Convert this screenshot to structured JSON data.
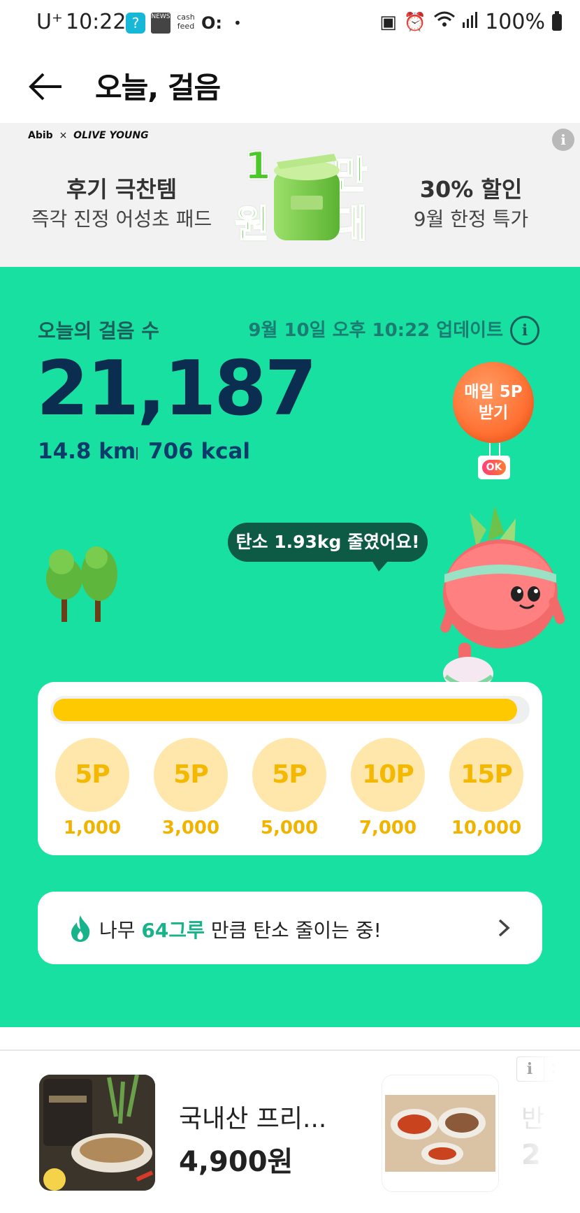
{
  "status_bar": {
    "carrier": "U⁺",
    "time": "10:22",
    "battery": "100%",
    "notifications": [
      "cash-app-icon",
      "news-icon",
      "cashfeed-icon",
      "o-app-icon",
      "dot"
    ],
    "cashfeed_text": "cash feed",
    "news_text": "NEWS"
  },
  "header": {
    "title": "오늘, 걸음"
  },
  "banner": {
    "brand": "Abib",
    "brand_x": "×",
    "brand_partner": "OLIVE YOUNG",
    "left_title": "후기 극찬템",
    "left_sub": "즉각 진정 어성초 패드",
    "promo_chars": [
      "1",
      "만",
      "원",
      "대"
    ],
    "right_title": "30% 할인",
    "right_sub": "9월 한정 특가",
    "info_label": "i"
  },
  "steps": {
    "label": "오늘의 걸음 수",
    "updated": "9월 10일 오후 10:22 업데이트",
    "count": "21,187",
    "distance": "14.8 km",
    "calories": "706 kcal",
    "balloon_line1": "매일 5P",
    "balloon_line2": "받기",
    "ok_badge": "OK",
    "carbon_bubble": "탄소 1.93kg 줄였어요!",
    "progress_fraction": 0.98
  },
  "rewards": [
    {
      "points": "5P",
      "threshold": "1,000"
    },
    {
      "points": "5P",
      "threshold": "3,000"
    },
    {
      "points": "5P",
      "threshold": "5,000"
    },
    {
      "points": "10P",
      "threshold": "7,000"
    },
    {
      "points": "15P",
      "threshold": "10,000"
    }
  ],
  "trees": {
    "prefix": "나무 ",
    "highlight": "64그루",
    "suffix": " 만큼 탄소 줄이는 중!"
  },
  "ad_products": [
    {
      "name": "국내산 프리...",
      "price": "4,900원"
    },
    {
      "name": "반",
      "price": "2"
    }
  ],
  "ad_controls": {
    "info": "i",
    "close": "✕"
  },
  "colors": {
    "main_green": "#18e0a1",
    "progress_yellow": "#ffc900",
    "reward_circle": "#ffe7ac",
    "step_text": "#0b2d4f",
    "highlight": "#19b38b"
  }
}
